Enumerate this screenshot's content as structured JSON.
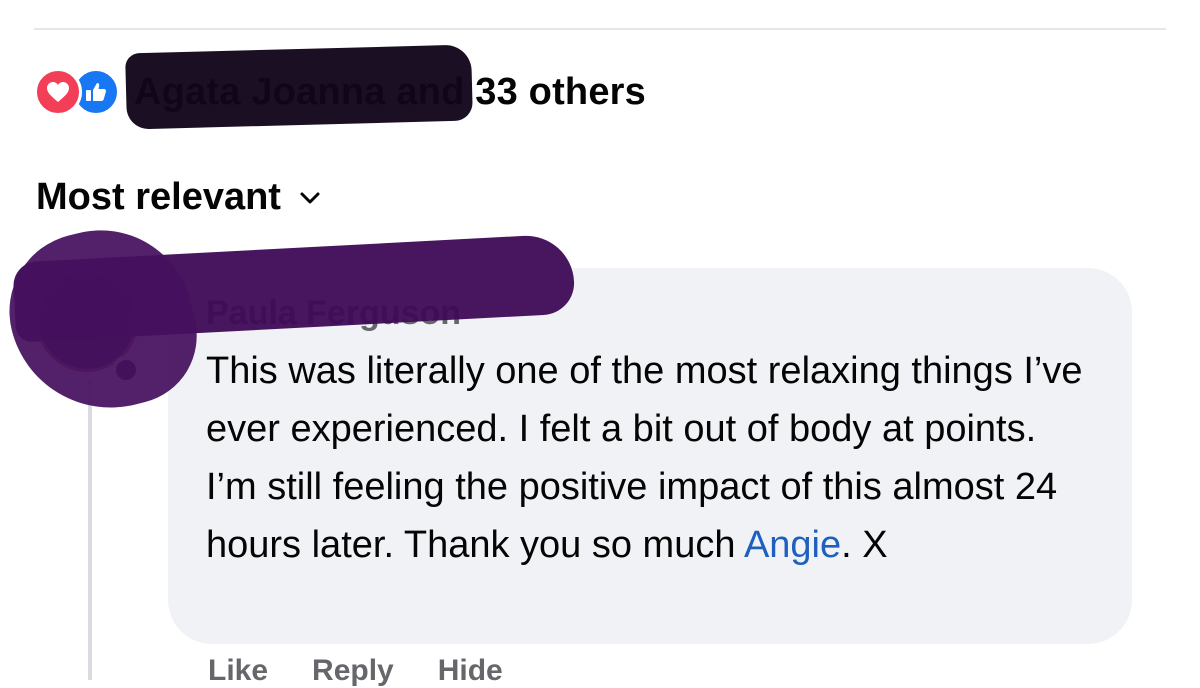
{
  "reactions": {
    "icons": [
      "heart-icon",
      "thumbs-up-icon"
    ],
    "love_color": "#f33e58",
    "like_color": "#1877f2",
    "names_text": "Agata Joanna and 33 others"
  },
  "sort": {
    "label": "Most relevant",
    "icon": "chevron-down-icon"
  },
  "comment": {
    "author": "Paula Ferguson",
    "text_before_mention": "This was literally one of the most relaxing things I’ve ever experienced. I felt a bit out of body at points. I’m still feeling the positive impact of this almost 24 hours later. Thank you so much ",
    "mention": "Angie",
    "text_after_mention": ". X",
    "mention_color": "#1f5fbf",
    "bubble_color": "#f0f2f5"
  },
  "comment_actions": {
    "like_label": "Like",
    "reply_label": "Reply",
    "hide_label": "Hide"
  },
  "redaction_color": "#3d0a55"
}
